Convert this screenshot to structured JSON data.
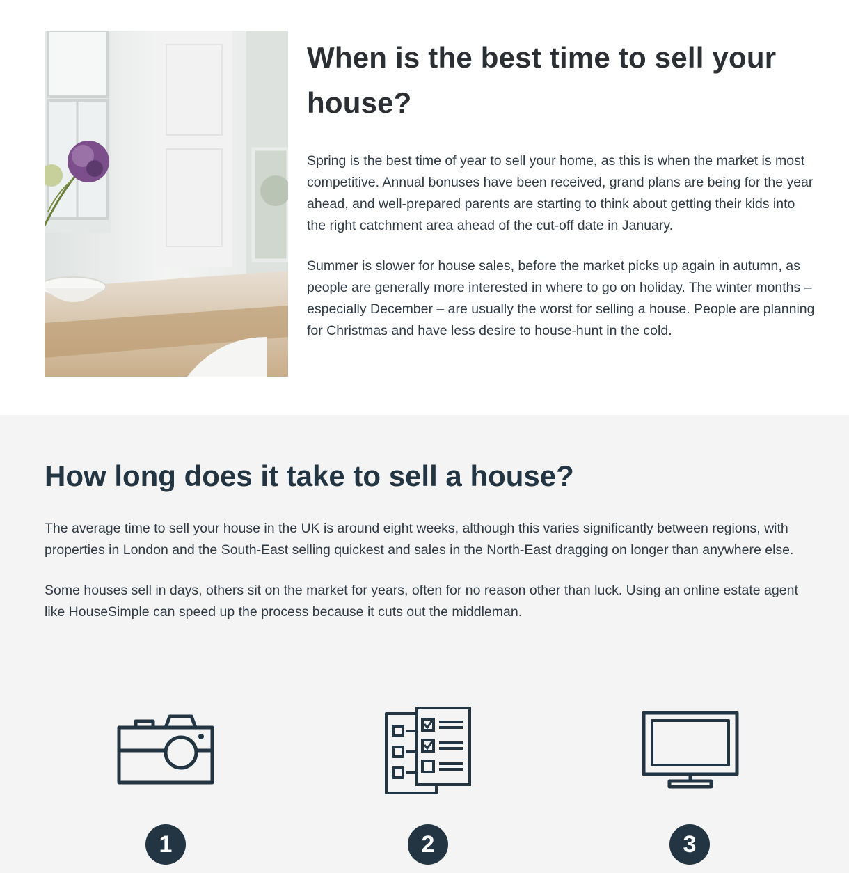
{
  "when": {
    "heading": "When is the best time to sell your house?",
    "paragraphs": [
      "Spring is the best time of year to sell your home, as this is when the market is most competitive. Annual bonuses have been received, grand plans are being for the year ahead, and well-prepared parents are starting to think about getting their kids into the right catchment area ahead of the cut-off date in January.",
      "Summer is slower for house sales, before the market picks up again in autumn, as people are generally more interested in where to go on holiday. The winter months – especially December – are usually the worst for selling a house. People are planning for Christmas and have less desire to house-hunt in the cold."
    ],
    "image_icon": "kitchen-table-photo"
  },
  "howlong": {
    "heading": "How long does it take to sell a house?",
    "paragraphs": [
      "The average time to sell your house in the UK is around eight weeks, although this varies significantly between regions, with properties in London and the South-East selling quickest and sales in the North-East dragging on longer than anywhere else.",
      "Some houses sell in days, others sit on the market for years, often for no reason other than luck. Using an online estate agent like HouseSimple can speed up the process because it cuts out the middleman."
    ]
  },
  "steps": [
    {
      "number": "1",
      "icon": "camera-icon"
    },
    {
      "number": "2",
      "icon": "checklist-icon"
    },
    {
      "number": "3",
      "icon": "monitor-icon"
    }
  ],
  "colors": {
    "navy": "#233542",
    "grey_bg": "#f4f4f4"
  }
}
